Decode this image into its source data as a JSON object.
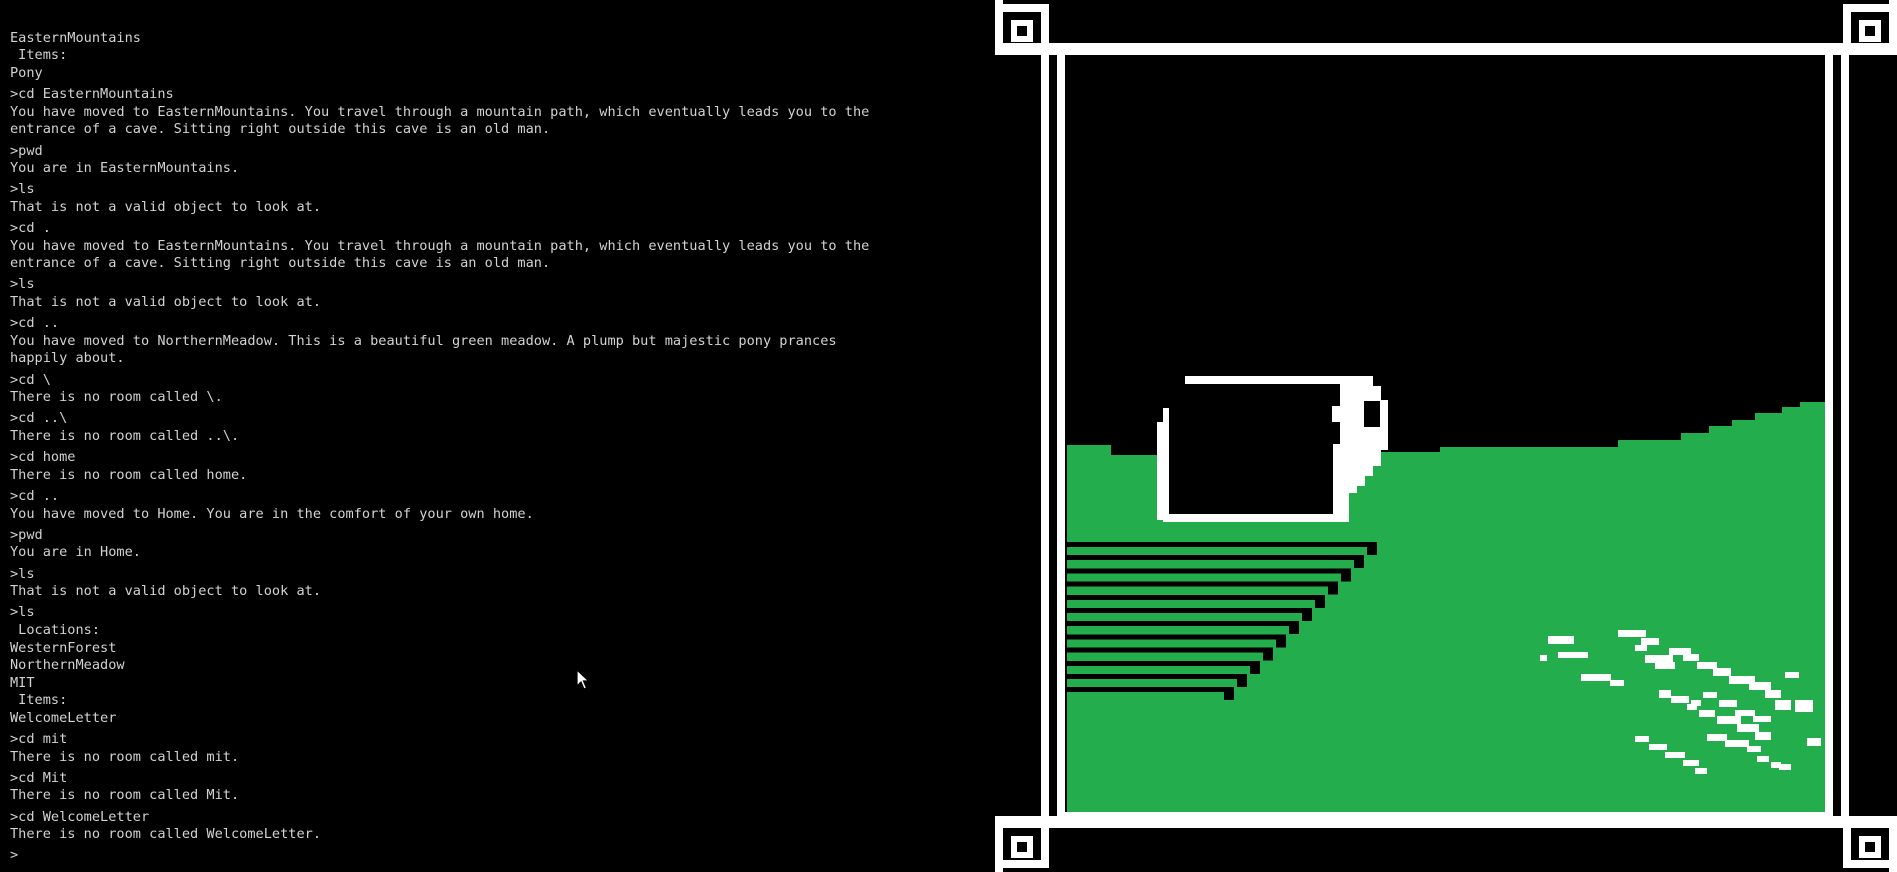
{
  "terminal": {
    "lines": [
      {
        "kind": "out",
        "text": "EasternMountains"
      },
      {
        "kind": "out",
        "text": " Items:"
      },
      {
        "kind": "out",
        "text": "Pony"
      },
      {
        "kind": "cmd",
        "text": ">cd EasternMountains"
      },
      {
        "kind": "out",
        "text": "You have moved to EasternMountains. You travel through a mountain path, which eventually leads you to the"
      },
      {
        "kind": "out",
        "text": "entrance of a cave. Sitting right outside this cave is an old man."
      },
      {
        "kind": "cmd",
        "text": ">pwd"
      },
      {
        "kind": "out",
        "text": "You are in EasternMountains."
      },
      {
        "kind": "cmd",
        "text": ">ls"
      },
      {
        "kind": "out",
        "text": "That is not a valid object to look at."
      },
      {
        "kind": "cmd",
        "text": ">cd ."
      },
      {
        "kind": "out",
        "text": "You have moved to EasternMountains. You travel through a mountain path, which eventually leads you to the"
      },
      {
        "kind": "out",
        "text": "entrance of a cave. Sitting right outside this cave is an old man."
      },
      {
        "kind": "cmd",
        "text": ">ls"
      },
      {
        "kind": "out",
        "text": "That is not a valid object to look at."
      },
      {
        "kind": "cmd",
        "text": ">cd .."
      },
      {
        "kind": "out",
        "text": "You have moved to NorthernMeadow. This is a beautiful green meadow. A plump but majestic pony prances"
      },
      {
        "kind": "out",
        "text": "happily about."
      },
      {
        "kind": "cmd",
        "text": ">cd \\"
      },
      {
        "kind": "out",
        "text": "There is no room called \\."
      },
      {
        "kind": "cmd",
        "text": ">cd ..\\"
      },
      {
        "kind": "out",
        "text": "There is no room called ..\\."
      },
      {
        "kind": "cmd",
        "text": ">cd home"
      },
      {
        "kind": "out",
        "text": "There is no room called home."
      },
      {
        "kind": "cmd",
        "text": ">cd .."
      },
      {
        "kind": "out",
        "text": "You have moved to Home. You are in the comfort of your own home."
      },
      {
        "kind": "cmd",
        "text": ">pwd"
      },
      {
        "kind": "out",
        "text": "You are in Home."
      },
      {
        "kind": "cmd",
        "text": ">ls"
      },
      {
        "kind": "out",
        "text": "That is not a valid object to look at."
      },
      {
        "kind": "cmd",
        "text": ">ls"
      },
      {
        "kind": "out",
        "text": " Locations:"
      },
      {
        "kind": "out",
        "text": "WesternForest"
      },
      {
        "kind": "out",
        "text": "NorthernMeadow"
      },
      {
        "kind": "out",
        "text": "MIT"
      },
      {
        "kind": "out",
        "text": " Items:"
      },
      {
        "kind": "out",
        "text": "WelcomeLetter"
      },
      {
        "kind": "cmd",
        "text": ">cd mit"
      },
      {
        "kind": "out",
        "text": "There is no room called mit."
      },
      {
        "kind": "cmd",
        "text": ">cd Mit"
      },
      {
        "kind": "out",
        "text": "There is no room called Mit."
      },
      {
        "kind": "cmd",
        "text": ">cd WelcomeLetter"
      },
      {
        "kind": "out",
        "text": "There is no room called WelcomeLetter."
      },
      {
        "kind": "cmd",
        "text": ">"
      }
    ]
  },
  "scene": {
    "colors": {
      "grass": "#24ad4c",
      "frame": "#ffffff",
      "sky": "#000000",
      "text": "#d2d2d2"
    },
    "icons": [
      "mouse-pointer-icon"
    ]
  }
}
